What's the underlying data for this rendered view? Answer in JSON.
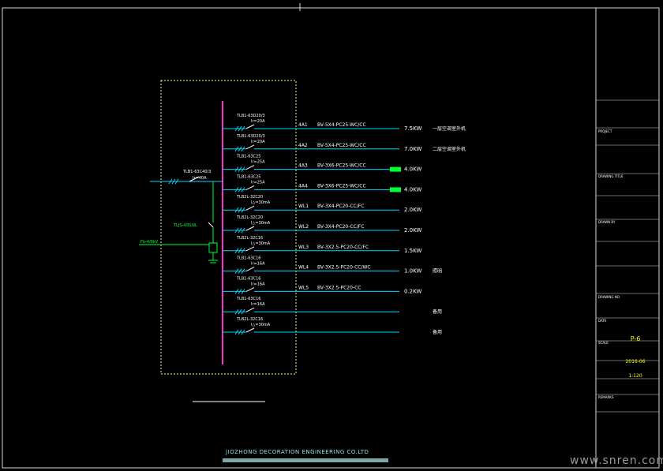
{
  "colors": {
    "background": "#000000",
    "frame": "#d9d9d9",
    "panel": "#ffff66",
    "busbar": "#ff33cc",
    "circuit": "#00d8ff",
    "label": "#ffffff",
    "accent": "#00ff33",
    "title_yellow": "#ffff00"
  },
  "diagram": {
    "main_breaker": {
      "model": "TLB1-63C40/3",
      "rating": "Ir=40A"
    },
    "surge": {
      "label": "TLJS-4/8LNL",
      "note": "",
      "model": "Fb-4/8kV"
    },
    "circuits": [
      {
        "breaker": "TLB1-63D20/3",
        "rating": "Ir=20A",
        "code": "4A1",
        "cable": "BV-5X4-PC25-WC/CC",
        "power": "7.5KW",
        "load": "一层空调室外机"
      },
      {
        "breaker": "TLB1-63D20/3",
        "rating": "Ir=20A",
        "code": "4A2",
        "cable": "BV-5X4-PC25-WC/CC",
        "power": "7.0KW",
        "load": "二层空调室外机"
      },
      {
        "breaker": "TLB1-63C25",
        "rating": "Ir=25A",
        "code": "4A3",
        "cable": "BV-3X6-PC25-WC/CC",
        "power": "4.0KW",
        "load": ""
      },
      {
        "breaker": "TLB1-63C25",
        "rating": "Ir=25A",
        "code": "4A4",
        "cable": "BV-3X6-PC25-WC/CC",
        "power": "4.0KW",
        "load": ""
      },
      {
        "breaker": "TLB2L-32C20",
        "rating": "I△=30mA",
        "code": "WL1",
        "cable": "BV-3X4-PC20-CC/FC",
        "power": "2.0KW",
        "load": ""
      },
      {
        "breaker": "TLB2L-32C20",
        "rating": "I△=30mA",
        "code": "WL2",
        "cable": "BV-3X4-PC20-CC/FC",
        "power": "2.0KW",
        "load": ""
      },
      {
        "breaker": "TLB2L-32C16",
        "rating": "I△=30mA",
        "code": "WL3",
        "cable": "BV-3X2.5-PC20-CC/FC",
        "power": "1.5KW",
        "load": ""
      },
      {
        "breaker": "TLB1-63C16",
        "rating": "Ir=16A",
        "code": "WL4",
        "cable": "BV-3X2.5-PC20-CC/WC",
        "power": "1.0KW",
        "load": "照明"
      },
      {
        "breaker": "TLB1-63C16",
        "rating": "Ir=16A",
        "code": "WL5",
        "cable": "BV-3X2.5-PC20-CC",
        "power": "0.2KW",
        "load": ""
      },
      {
        "breaker": "TLB1-63C16",
        "rating": "Ir=16A",
        "code": "",
        "cable": "",
        "power": "",
        "load": "备用"
      },
      {
        "breaker": "TLB2L-32C16",
        "rating": "I△=30mA",
        "code": "",
        "cable": "",
        "power": "",
        "load": "备用"
      }
    ],
    "caption": ""
  },
  "title_block": {
    "fields": [
      {
        "label": "",
        "value": ""
      },
      {
        "label": "PROJECT",
        "value": ""
      },
      {
        "label": "",
        "value": ""
      },
      {
        "label": "DRAWING TITLE",
        "value": ""
      },
      {
        "label": "",
        "value": ""
      },
      {
        "label": "DRAWN BY",
        "value": ""
      },
      {
        "label": "",
        "value": ""
      },
      {
        "label": "",
        "value": ""
      },
      {
        "label": "DRAWING NO.",
        "value": ""
      },
      {
        "label": "DATE",
        "value": ""
      },
      {
        "label": "SCALE",
        "value": ""
      },
      {
        "label": "",
        "value": ""
      },
      {
        "label": "REMARKS",
        "value": ""
      }
    ],
    "project_name": "",
    "drawing_name": "",
    "drawing_no": "P-6",
    "date": "2016-06",
    "scale": "1:120"
  },
  "footer": {
    "company": "JIOZHONG DECORATION ENGINEERING CO.LTD",
    "watermark": "www.snren.com"
  }
}
